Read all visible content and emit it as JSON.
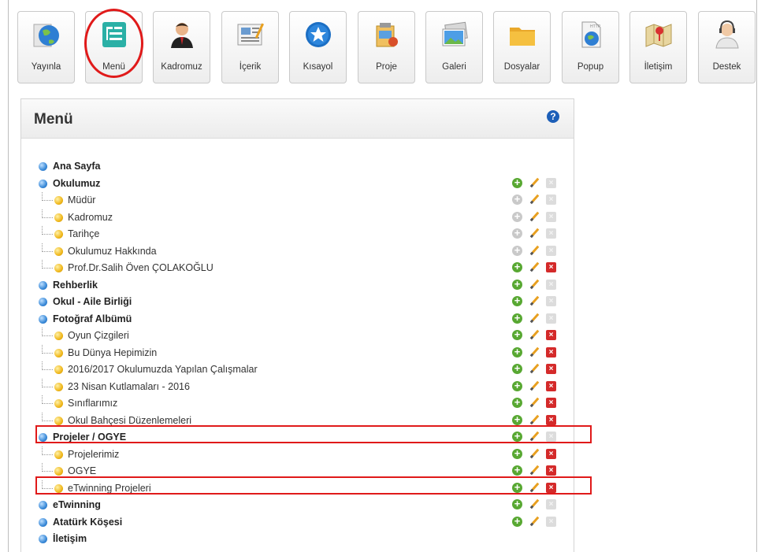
{
  "toolbar": {
    "buttons": [
      {
        "label": "Yayınla",
        "icon": "globe-icon"
      },
      {
        "label": "Menü",
        "icon": "menu-tree-icon"
      },
      {
        "label": "Kadromuz",
        "icon": "staff-person-icon"
      },
      {
        "label": "İçerik",
        "icon": "content-document-icon"
      },
      {
        "label": "Kısayol",
        "icon": "shortcut-star-icon"
      },
      {
        "label": "Proje",
        "icon": "project-icon"
      },
      {
        "label": "Galeri",
        "icon": "gallery-photo-icon"
      },
      {
        "label": "Dosyalar",
        "icon": "folder-icon"
      },
      {
        "label": "Popup",
        "icon": "popup-http-icon"
      },
      {
        "label": "İletişim",
        "icon": "contact-map-icon"
      },
      {
        "label": "Destek",
        "icon": "support-headset-icon"
      }
    ]
  },
  "panel": {
    "title": "Menü",
    "help_symbol": "?"
  },
  "actions": {
    "add_symbol": "+",
    "delete_symbol": "×"
  },
  "menu_tree": [
    {
      "label": "Ana Sayfa",
      "level": 0,
      "add": "none",
      "delete": "none"
    },
    {
      "label": "Okulumuz",
      "level": 0,
      "add": "on",
      "delete": "off"
    },
    {
      "label": "Müdür",
      "level": 1,
      "add": "off",
      "delete": "off"
    },
    {
      "label": "Kadromuz",
      "level": 1,
      "add": "off",
      "delete": "off"
    },
    {
      "label": "Tarihçe",
      "level": 1,
      "add": "off",
      "delete": "off"
    },
    {
      "label": "Okulumuz Hakkında",
      "level": 1,
      "add": "off",
      "delete": "off"
    },
    {
      "label": "Prof.Dr.Salih Öven ÇOLAKOĞLU",
      "level": 1,
      "add": "on",
      "delete": "on"
    },
    {
      "label": "Rehberlik",
      "level": 0,
      "add": "on",
      "delete": "off"
    },
    {
      "label": "Okul - Aile Birliği",
      "level": 0,
      "add": "on",
      "delete": "off"
    },
    {
      "label": "Fotoğraf Albümü",
      "level": 0,
      "add": "on",
      "delete": "off"
    },
    {
      "label": "Oyun Çizgileri",
      "level": 1,
      "add": "on",
      "delete": "on"
    },
    {
      "label": "Bu Dünya Hepimizin",
      "level": 1,
      "add": "on",
      "delete": "on"
    },
    {
      "label": "2016/2017 Okulumuzda Yapılan Çalışmalar",
      "level": 1,
      "add": "on",
      "delete": "on"
    },
    {
      "label": "23 Nisan Kutlamaları - 2016",
      "level": 1,
      "add": "on",
      "delete": "on"
    },
    {
      "label": "Sınıflarımız",
      "level": 1,
      "add": "on",
      "delete": "on"
    },
    {
      "label": "Okul Bahçesi Düzenlemeleri",
      "level": 1,
      "add": "on",
      "delete": "on"
    },
    {
      "label": "Projeler / OGYE",
      "level": 0,
      "add": "on",
      "delete": "off"
    },
    {
      "label": "Projelerimiz",
      "level": 1,
      "add": "on",
      "delete": "on"
    },
    {
      "label": "OGYE",
      "level": 1,
      "add": "on",
      "delete": "on"
    },
    {
      "label": "eTwinning Projeleri",
      "level": 1,
      "add": "on",
      "delete": "on"
    },
    {
      "label": "eTwinning",
      "level": 0,
      "add": "on",
      "delete": "off"
    },
    {
      "label": "Atatürk Köşesi",
      "level": 0,
      "add": "on",
      "delete": "off"
    },
    {
      "label": "İletişim",
      "level": 0,
      "add": "none",
      "delete": "none"
    }
  ],
  "colors": {
    "highlight": "#e01a1a",
    "add_green": "#58a832",
    "delete_red": "#d42a2a"
  }
}
